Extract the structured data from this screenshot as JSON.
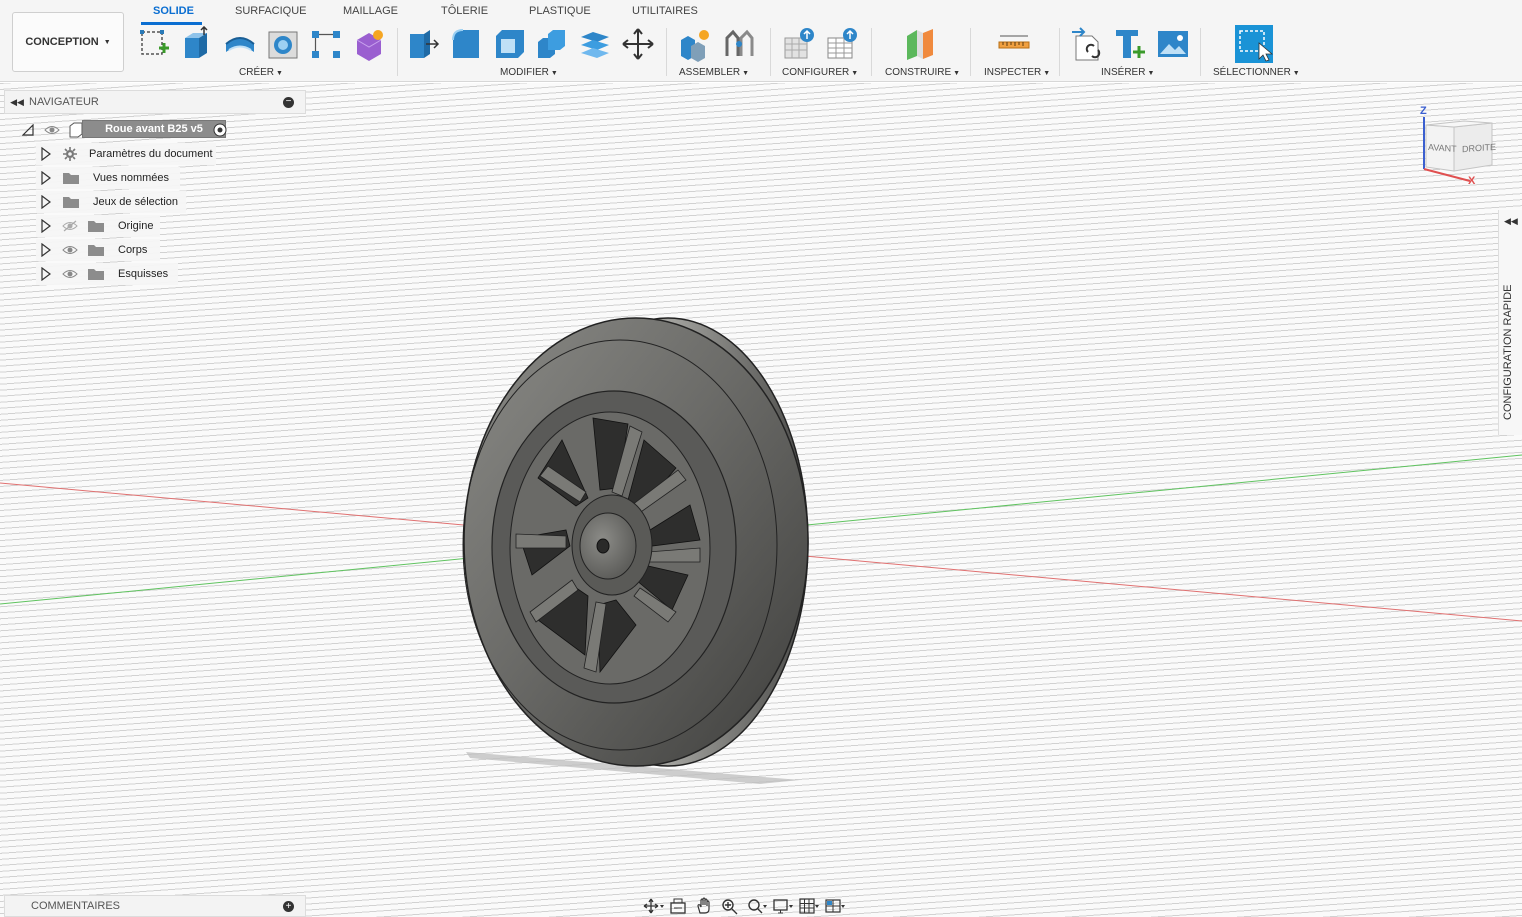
{
  "workspace": {
    "label": "CONCEPTION"
  },
  "tabs": [
    {
      "label": "SOLIDE",
      "active": true
    },
    {
      "label": "SURFACIQUE"
    },
    {
      "label": "MAILLAGE"
    },
    {
      "label": "TÔLERIE"
    },
    {
      "label": "PLASTIQUE"
    },
    {
      "label": "UTILITAIRES"
    }
  ],
  "groups": [
    {
      "label": "CRÉER"
    },
    {
      "label": "MODIFIER"
    },
    {
      "label": "ASSEMBLER"
    },
    {
      "label": "CONFIGURER"
    },
    {
      "label": "CONSTRUIRE"
    },
    {
      "label": "INSPECTER"
    },
    {
      "label": "INSÉRER"
    },
    {
      "label": "SÉLECTIONNER"
    }
  ],
  "navigator": {
    "title": "NAVIGATEUR",
    "root": "Roue avant B25 v5",
    "items": [
      {
        "label": "Paramètres du document",
        "icon": "gear-icon"
      },
      {
        "label": "Vues nommées",
        "icon": "folder-icon"
      },
      {
        "label": "Jeux de sélection",
        "icon": "folder-icon"
      },
      {
        "label": "Origine",
        "icon": "folder-icon",
        "eye": "hidden"
      },
      {
        "label": "Corps",
        "icon": "folder-icon",
        "eye": "visible"
      },
      {
        "label": "Esquisses",
        "icon": "folder-icon",
        "eye": "visible"
      }
    ]
  },
  "viewcube": {
    "front": "AVANT",
    "right": "DROITE",
    "axis_z": "Z",
    "axis_x": "X"
  },
  "right_panel": {
    "label": "CONFIGURATION RAPIDE"
  },
  "comments": {
    "label": "COMMENTAIRES"
  },
  "colors": {
    "accent": "#0a6ed1",
    "x_axis": "#e05050",
    "y_axis": "#4cbf4c",
    "wheel": "#6e6e6c"
  }
}
